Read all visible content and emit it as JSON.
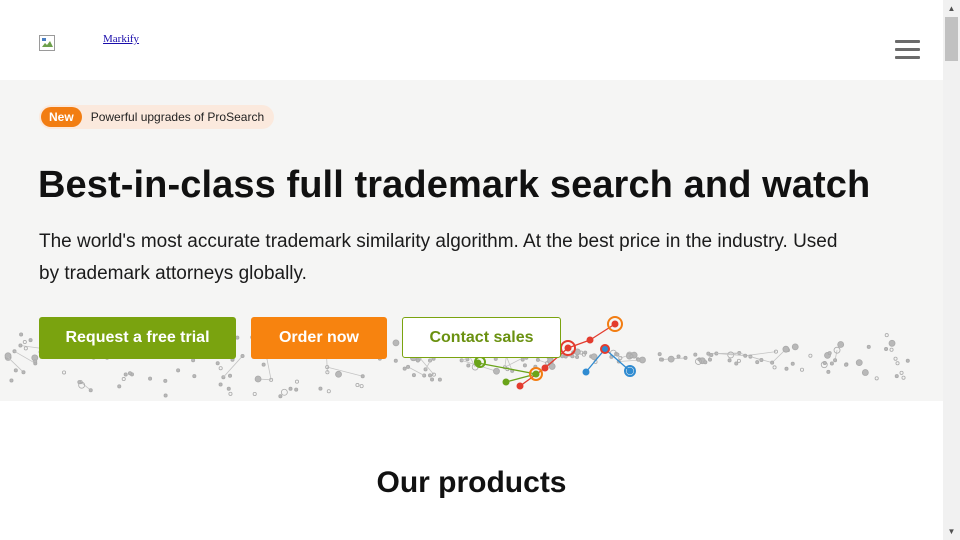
{
  "header": {
    "logo_text": "Markify"
  },
  "promo": {
    "badge": "New",
    "text": "Powerful upgrades of ProSearch"
  },
  "hero": {
    "title": "Best-in-class full trademark search and watch",
    "subtitle": "The world's most accurate trademark similarity algorithm. At the best price in the industry. Used by trademark attorneys globally."
  },
  "buttons": {
    "trial": "Request a free trial",
    "order": "Order now",
    "contact": "Contact sales"
  },
  "products": {
    "title": "Our products"
  },
  "colors": {
    "green": "#7aa30f",
    "orange": "#f7830f",
    "hero_bg": "#f5f5f4",
    "badge_orange": "#f27d12"
  },
  "icons": {
    "menu": "hamburger-menu-icon",
    "logo": "broken-image-icon"
  }
}
